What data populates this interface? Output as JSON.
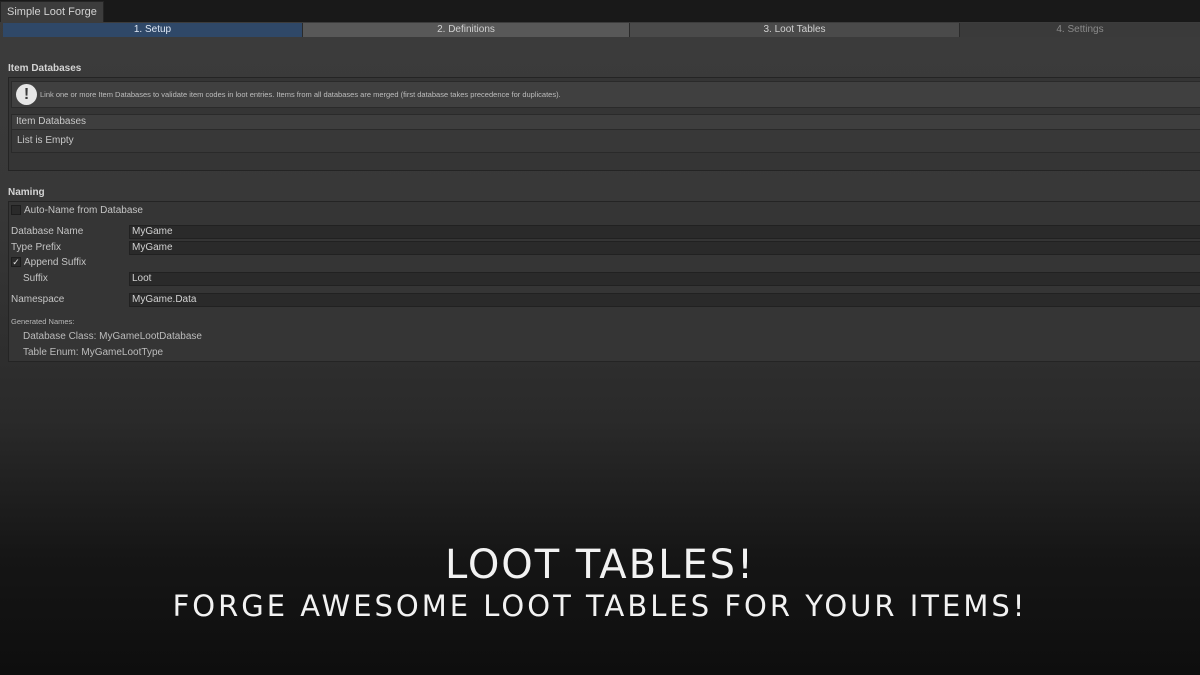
{
  "window": {
    "tab_title": "Simple Loot Forge"
  },
  "steps": [
    {
      "label": "1. Setup"
    },
    {
      "label": "2. Definitions"
    },
    {
      "label": "3. Loot Tables"
    },
    {
      "label": "4. Settings"
    }
  ],
  "item_databases": {
    "section_title": "Item Databases",
    "help_text": "Link one or more Item Databases to validate item codes in loot entries. Items from all databases are merged (first database takes precedence for duplicates).",
    "list_header": "Item Databases",
    "list_empty": "List is Empty"
  },
  "naming": {
    "section_title": "Naming",
    "auto_name_label": "Auto-Name from Database",
    "auto_name_checked": false,
    "database_name_label": "Database Name",
    "database_name_value": "MyGame",
    "type_prefix_label": "Type Prefix",
    "type_prefix_value": "MyGame",
    "append_suffix_label": "Append Suffix",
    "append_suffix_checked": true,
    "check_mark": "✓",
    "suffix_label": "Suffix",
    "suffix_value": "Loot",
    "namespace_label": "Namespace",
    "namespace_value": "MyGame.Data",
    "generated_names_label": "Generated Names:",
    "database_class_line": "Database Class: MyGameLootDatabase",
    "table_enum_line": "Table Enum: MyGameLootType"
  },
  "banner": {
    "title": "LOOT TABLES!",
    "subtitle": "FORGE AWESOME LOOT TABLES FOR YOUR ITEMS!"
  },
  "colors": {
    "active_step": "#2f4868",
    "panel": "#353535",
    "input": "#2a2a2a"
  }
}
